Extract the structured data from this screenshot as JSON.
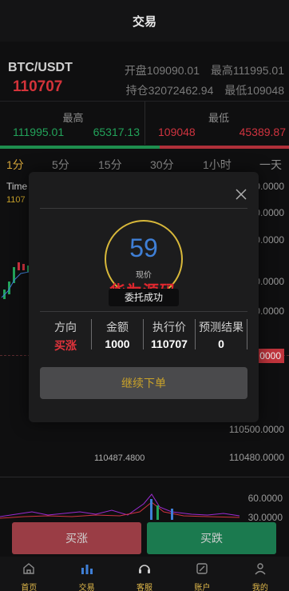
{
  "header": {
    "title": "交易"
  },
  "ticker": {
    "pair": "BTC/USDT",
    "last_price": "110707",
    "open": "开盘109090.01",
    "high": "最高111995.01",
    "position": "持仓32072462.94",
    "low": "最低109048"
  },
  "high_low": {
    "high_label": "最高",
    "high_v1": "111995.01",
    "high_v2": "65317.13",
    "low_label": "最低",
    "low_v1": "109048",
    "low_v2": "45389.87"
  },
  "periods": [
    "1分",
    "5分",
    "15分",
    "30分",
    "1小时",
    "一天"
  ],
  "chart": {
    "time_label": "Time",
    "yellow_value": "1107",
    "axis": [
      "0.0000",
      "0.0000",
      "0.0000",
      "0.0000",
      "0.0000",
      "110500.0000",
      "110480.0000"
    ],
    "price_tag": "0000",
    "low_note": "110487.4800",
    "vol_axis": [
      "60.0000",
      "30.0000"
    ]
  },
  "modal": {
    "countdown": "59",
    "caption": "现价",
    "watermark": "华为源码",
    "toast": "委托成功",
    "headers": [
      "方向",
      "金额",
      "执行价",
      "预测结果"
    ],
    "values": [
      "买涨",
      "1000",
      "110707",
      "0"
    ],
    "continue_label": "继续下单"
  },
  "actions": {
    "buy_up": "买涨",
    "buy_down": "买跌"
  },
  "tabs": [
    {
      "label": "首页",
      "icon": "home-icon"
    },
    {
      "label": "交易",
      "icon": "chart-icon"
    },
    {
      "label": "客服",
      "icon": "headset-icon"
    },
    {
      "label": "账户",
      "icon": "wallet-icon"
    },
    {
      "label": "我的",
      "icon": "user-icon"
    }
  ],
  "colors": {
    "up": "#d0333f",
    "down": "#22a35a",
    "accent": "#d4a53a"
  }
}
